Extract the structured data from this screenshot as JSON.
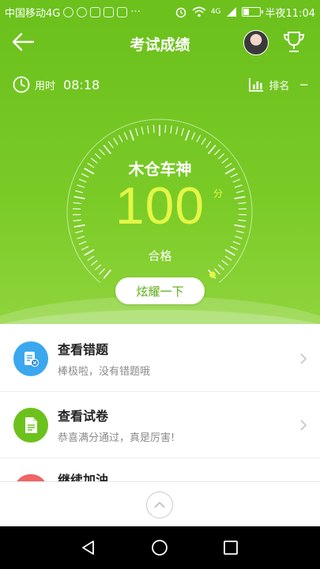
{
  "status_bar": {
    "carrier": "中国移动4G",
    "network": "4G",
    "time": "半夜11:04",
    "battery_level": 0.35
  },
  "header": {
    "title": "考试成绩",
    "back_icon": "arrow-left-icon",
    "trophy_icon": "trophy-icon"
  },
  "stats": {
    "time_label": "用时",
    "time_value": "08:18",
    "rank_label": "排名",
    "rank_value": "−"
  },
  "result": {
    "rank_title": "木仓车神",
    "score": "100",
    "score_unit": "分",
    "pass_label": "合格",
    "score_fraction": 1.0,
    "share_button": "炫耀一下"
  },
  "list": {
    "items": [
      {
        "title": "查看错题",
        "subtitle": "棒极啦，没有错题哦",
        "icon": "wrong-questions-icon",
        "color": "#3aa7ef"
      },
      {
        "title": "查看试卷",
        "subtitle": "恭喜满分通过，真是厉害!",
        "icon": "exam-paper-icon",
        "color": "#6cc11d"
      },
      {
        "title": "继续加油",
        "subtitle": "",
        "icon": "keep-going-icon",
        "color": "#f06464"
      }
    ]
  },
  "colors": {
    "primary_green": "#6cc11d",
    "score_yellow": "#e3f746",
    "button_text": "#5cad16"
  }
}
